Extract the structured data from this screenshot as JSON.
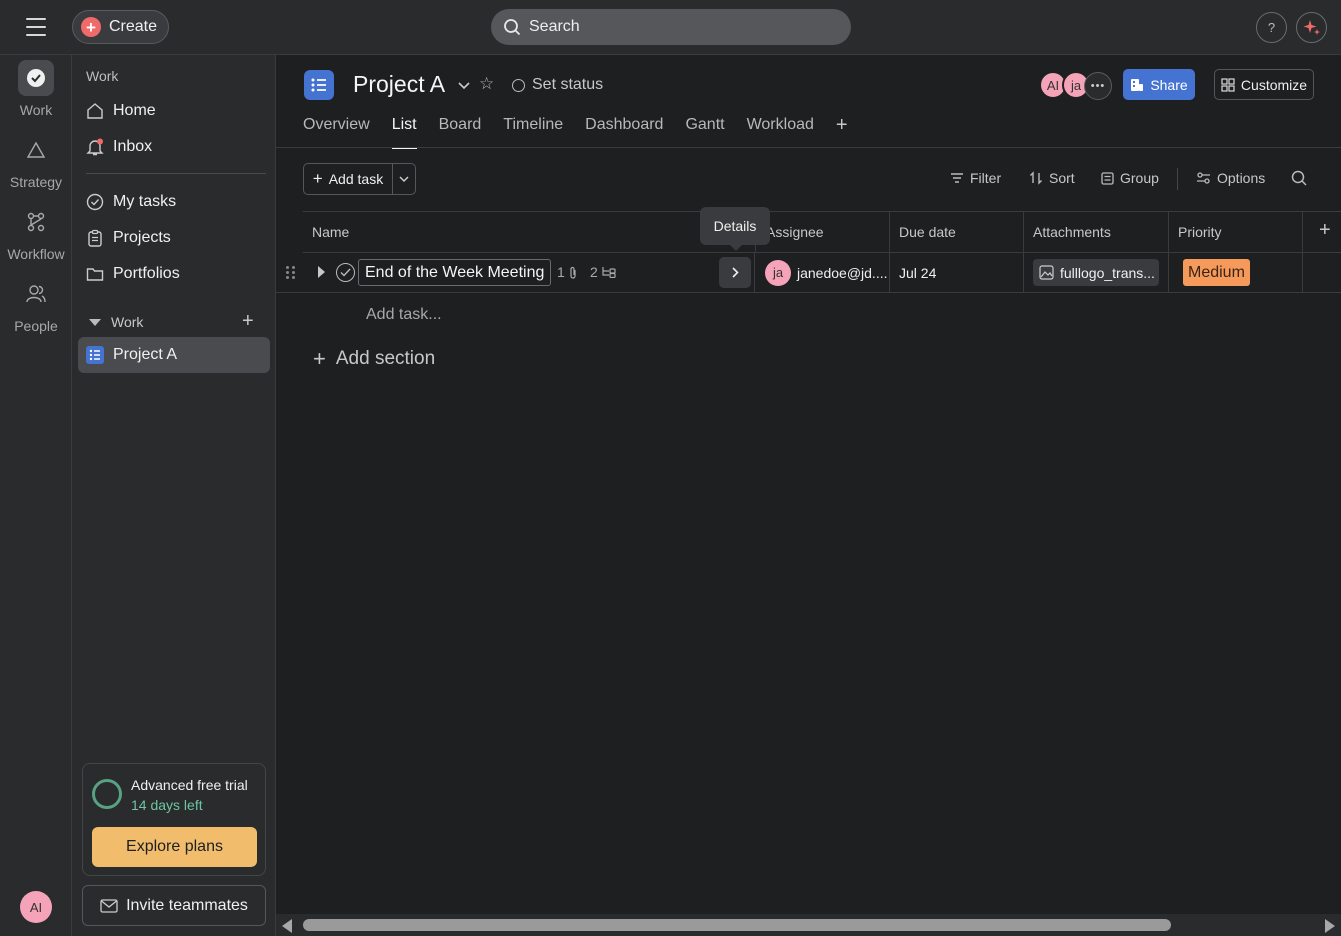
{
  "topbar": {
    "create_label": "Create",
    "search_placeholder": "Search",
    "help_label": "?"
  },
  "rail": {
    "items": [
      {
        "label": "Work",
        "icon": "check-circle-icon"
      },
      {
        "label": "Strategy",
        "icon": "triangle-icon"
      },
      {
        "label": "Workflow",
        "icon": "workflow-icon"
      },
      {
        "label": "People",
        "icon": "people-icon"
      }
    ],
    "user_initials": "AI"
  },
  "sidebar": {
    "section_label": "Work",
    "items": [
      {
        "label": "Home",
        "icon": "home-icon"
      },
      {
        "label": "Inbox",
        "icon": "bell-icon"
      },
      {
        "label": "My tasks",
        "icon": "check-circle-icon"
      },
      {
        "label": "Projects",
        "icon": "clipboard-icon"
      },
      {
        "label": "Portfolios",
        "icon": "folder-icon"
      }
    ],
    "team_section_label": "Work",
    "projects": [
      {
        "label": "Project A",
        "icon": "list-icon"
      }
    ],
    "trial": {
      "title": "Advanced free trial",
      "days_left": "14 days left",
      "explore_label": "Explore plans"
    },
    "invite_label": "Invite teammates"
  },
  "header": {
    "project_title": "Project A",
    "set_status_label": "Set status",
    "members": [
      {
        "initials": "AI",
        "color": "#f5a3b8"
      },
      {
        "initials": "ja",
        "color": "#f5a3b8"
      }
    ],
    "share_label": "Share",
    "customize_label": "Customize",
    "tabs": [
      "Overview",
      "List",
      "Board",
      "Timeline",
      "Dashboard",
      "Gantt",
      "Workload"
    ],
    "active_tab": "List"
  },
  "toolbar": {
    "add_task_label": "Add task",
    "filter_label": "Filter",
    "sort_label": "Sort",
    "group_label": "Group",
    "options_label": "Options"
  },
  "grid": {
    "columns": [
      "Name",
      "Assignee",
      "Due date",
      "Attachments",
      "Priority"
    ],
    "rows": [
      {
        "name": "End of the Week Meeting",
        "attachment_count": "1",
        "subtask_count": "2",
        "assignee_initials": "ja",
        "assignee": "janedoe@jd....",
        "due_date": "Jul 24",
        "attachment": "fulllogo_trans...",
        "priority": "Medium"
      }
    ],
    "details_tooltip": "Details",
    "add_task_inline": "Add task...",
    "add_section_label": "Add section"
  },
  "colors": {
    "accent_blue": "#4573d2",
    "create_red": "#f06a6a",
    "priority_medium": "#f59a5b",
    "trial_green": "#58a182",
    "explore_gold": "#f1bd6c"
  }
}
